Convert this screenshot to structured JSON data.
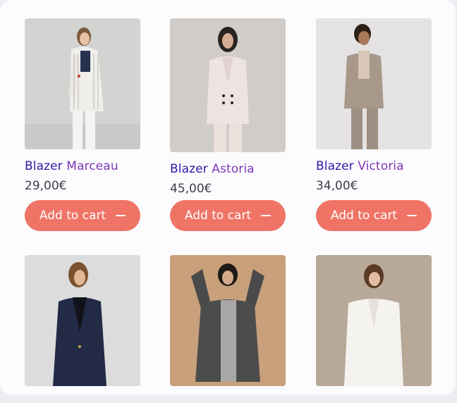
{
  "products": [
    {
      "name_1": "Blazer",
      "name_2": "Marceau",
      "price": "29,00€",
      "button": "Add to cart",
      "icon": "minus-icon"
    },
    {
      "name_1": "Blazer",
      "name_2": "Astoria",
      "price": "45,00€",
      "button": "Add to cart",
      "icon": "minus-icon"
    },
    {
      "name_1": "Blazer",
      "name_2": "Victoria",
      "price": "34,00€",
      "button": "Add to cart",
      "icon": "minus-icon"
    }
  ],
  "colors": {
    "button": "#ef7466",
    "name_primary": "#3216a6",
    "name_secondary": "#7d35b5",
    "price": "#3a3f4a"
  }
}
